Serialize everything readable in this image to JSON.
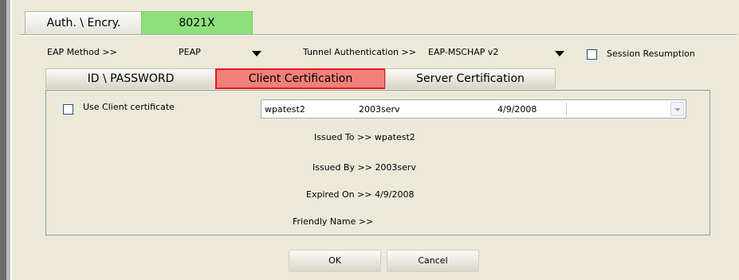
{
  "top_tabs": {
    "auth": "Auth. \\ Encry.",
    "method": "8021X"
  },
  "eap_row": {
    "eap_method_label": "EAP Method >>",
    "eap_method_value": "PEAP",
    "tunnel_auth_label": "Tunnel Authentication >>",
    "tunnel_auth_value": "EAP-MSCHAP v2",
    "session_resumption_label": "Session Resumption",
    "session_resumption_checked": false
  },
  "cert_tabs": [
    "ID \\ PASSWORD",
    "Client Certification",
    "Server Certification"
  ],
  "active_tab": "Client Certification",
  "client_cert": {
    "use_client_cert_label": "Use Client certificate",
    "use_client_cert_checked": false,
    "selected": {
      "name": "wpatest2",
      "issuer": "2003serv",
      "expires": "4/9/2008"
    },
    "issued_to": "Issued To >> wpatest2",
    "issued_by": "Issued By >> 2003serv",
    "expired_on": "Expired On >> 4/9/2008",
    "friendly_name": "Friendly Name >>"
  },
  "buttons": {
    "ok": "OK",
    "cancel": "Cancel"
  },
  "colors": {
    "active_tab_fill": "#f0807a",
    "active_tab_border": "#e8141a",
    "method_tab": "#8ee07c"
  }
}
